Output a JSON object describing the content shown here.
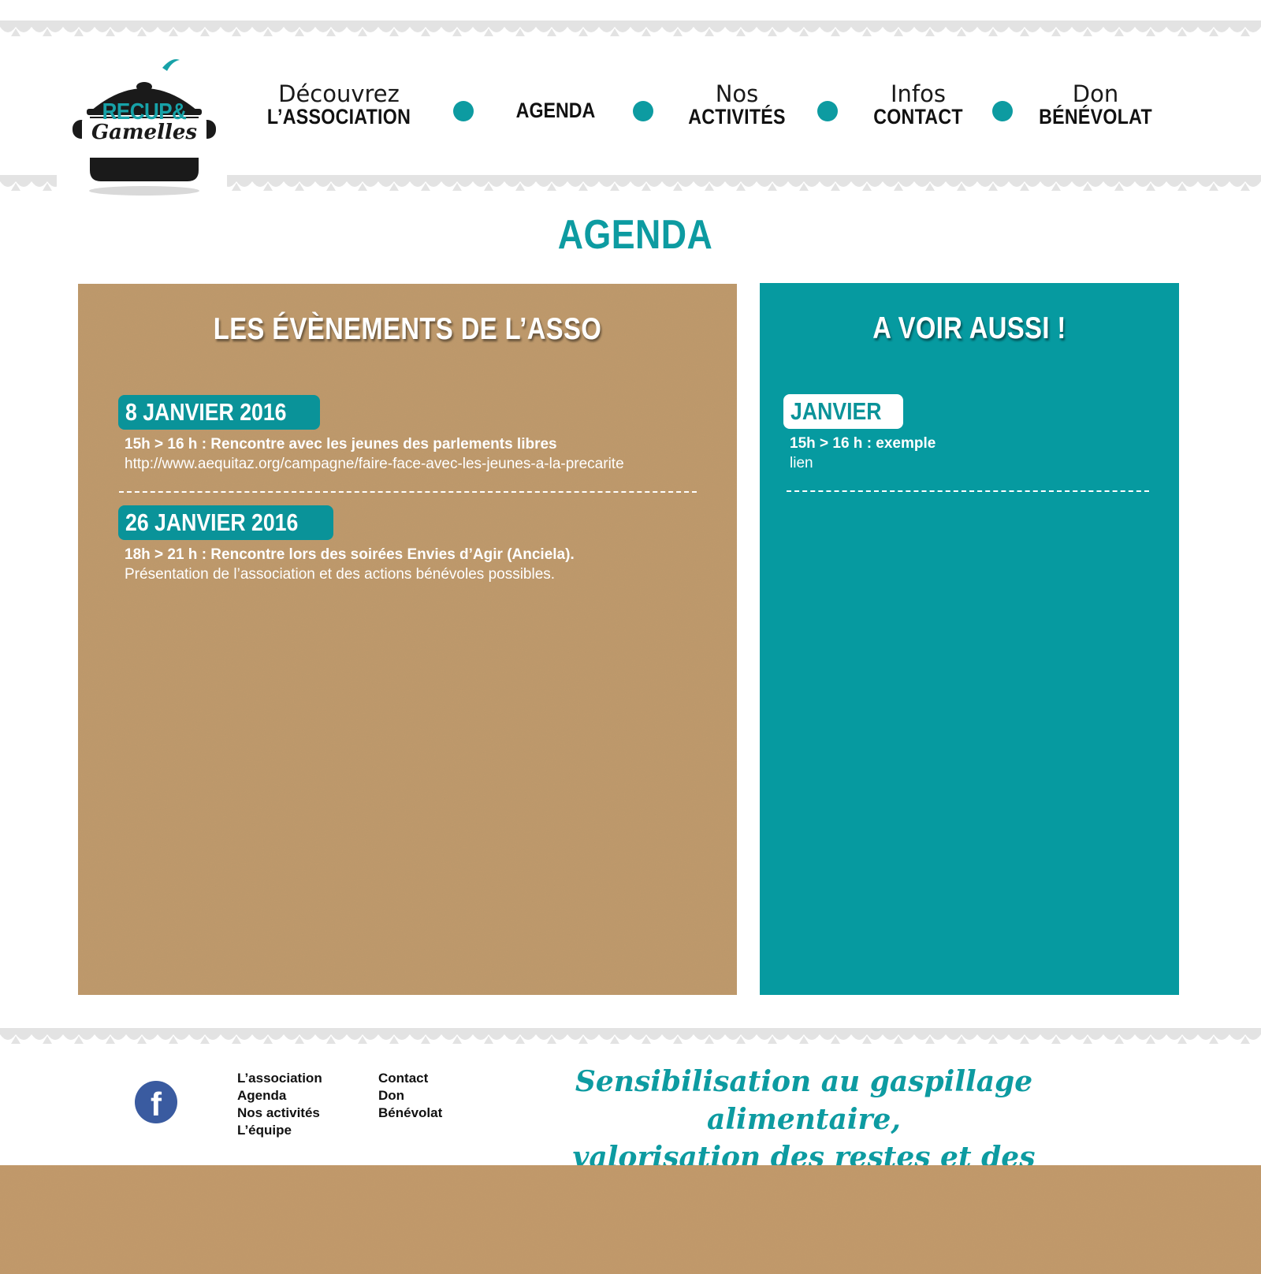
{
  "brand": {
    "logo_line1": "RECUP&",
    "logo_line2": "Gamelles"
  },
  "nav": {
    "items": [
      {
        "top": "Découvrez",
        "bottom": "L’ASSOCIATION"
      },
      {
        "top": "",
        "bottom": "AGENDA"
      },
      {
        "top": "Nos",
        "bottom": "ACTIVITÉS"
      },
      {
        "top": "Infos",
        "bottom": "CONTACT"
      },
      {
        "top": "Don",
        "bottom": "BÉNÉVOLAT"
      }
    ]
  },
  "page": {
    "title": "AGENDA"
  },
  "events_panel": {
    "heading": "LES ÉVÈNEMENTS DE L’ASSO",
    "events": [
      {
        "date": "8 JANVIER 2016",
        "time_title": "15h > 16 h : Rencontre avec les jeunes des parlements libres",
        "description": "http://www.aequitaz.org/campagne/faire-face-avec-les-jeunes-a-la-precarite"
      },
      {
        "date": "26 JANVIER 2016",
        "time_title": "18h > 21 h : Rencontre lors des soirées Envies d’Agir (Anciela).",
        "description": "Présentation de l’association et des actions bénévoles possibles."
      }
    ]
  },
  "see_also_panel": {
    "heading": "A VOIR AUSSI !",
    "events": [
      {
        "date": "JANVIER",
        "time_title": "15h > 16 h : exemple",
        "description": "lien"
      }
    ]
  },
  "footer": {
    "social_icon": "facebook-icon",
    "social_letter": "f",
    "links_col1": [
      "L’association",
      "Agenda",
      "Nos activités",
      "L’équipe"
    ],
    "links_col2": [
      "Contact",
      "Don",
      "Bénévolat"
    ],
    "tagline_line1": "Sensibilisation au gaspillage alimentaire,",
    "tagline_line2": "valorisation des restes et des invendus !"
  },
  "colors": {
    "accent": "#0d9ba1",
    "panel_right": "#069aa0",
    "cardboard": "#c09a6b",
    "scallop": "#e3e3e3",
    "facebook": "#3a5ba0"
  }
}
